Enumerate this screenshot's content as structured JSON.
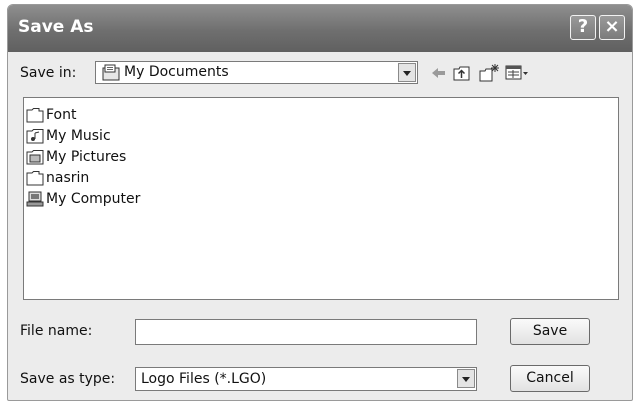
{
  "window": {
    "title": "Save As",
    "help_label": "?",
    "close_label": "×"
  },
  "toolbar": {
    "save_in_label": "Save in:",
    "save_in_value": "My Documents",
    "icons": [
      "back-icon",
      "up-folder-icon",
      "new-folder-icon",
      "views-menu-icon"
    ]
  },
  "file_list": [
    {
      "name": "Font",
      "icon": "folder-icon"
    },
    {
      "name": "My Music",
      "icon": "music-folder-icon"
    },
    {
      "name": "My Pictures",
      "icon": "pictures-folder-icon"
    },
    {
      "name": "nasrin",
      "icon": "folder-icon"
    },
    {
      "name": "My Computer",
      "icon": "computer-icon"
    }
  ],
  "form": {
    "file_name_label": "File name:",
    "file_name_value": "",
    "save_as_type_label": "Save as type:",
    "save_as_type_value": "Logo Files (*.LGO)"
  },
  "buttons": {
    "save": "Save",
    "cancel": "Cancel"
  }
}
